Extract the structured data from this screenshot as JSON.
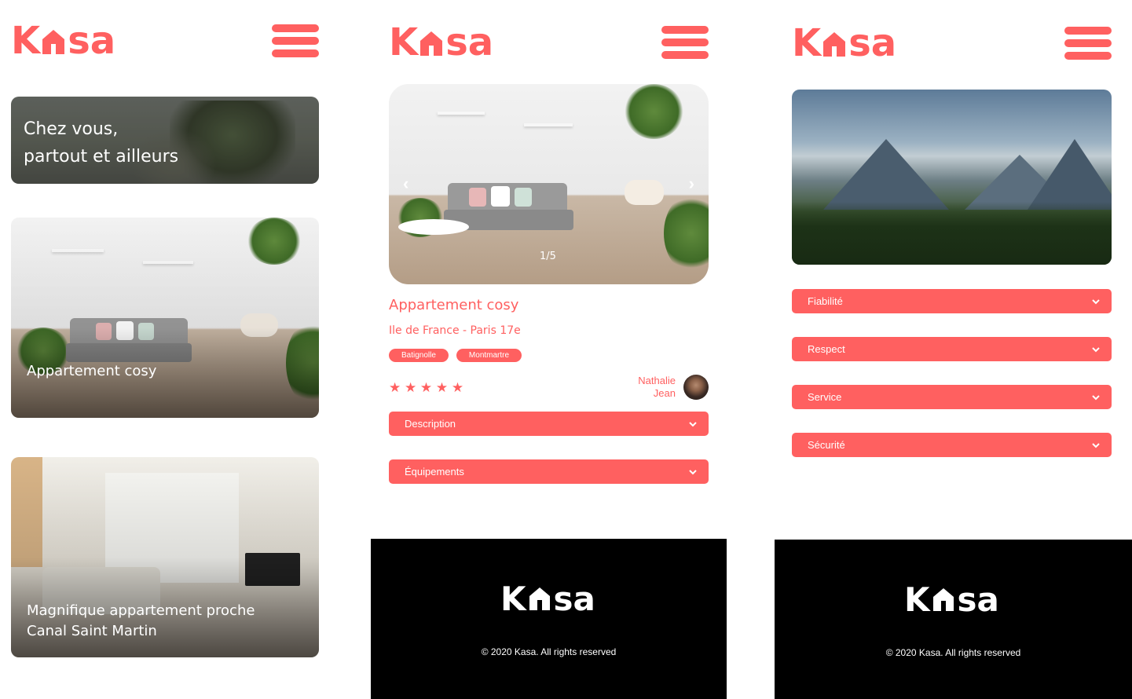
{
  "brand": {
    "logo_before": "K",
    "logo_after": "sa",
    "accent_color": "#FF6060",
    "menu_icon": "hamburger-icon"
  },
  "home": {
    "banner_line1": "Chez vous,",
    "banner_line2": "partout et ailleurs",
    "cards": [
      {
        "title": "Appartement cosy"
      },
      {
        "title": "Magnifique appartement proche Canal Saint Martin"
      }
    ]
  },
  "detail": {
    "counter": "1/5",
    "prev_icon": "chevron-left-icon",
    "next_icon": "chevron-right-icon",
    "title": "Appartement cosy",
    "location": "Ile de France - Paris 17e",
    "tags": [
      "Batignolle",
      "Montmartre"
    ],
    "rating": 5,
    "stars": "★ ★ ★ ★ ★",
    "host_first": "Nathalie",
    "host_last": "Jean",
    "collapses": [
      "Description",
      "Équipements"
    ]
  },
  "about": {
    "collapses": [
      "Fiabilité",
      "Respect",
      "Service",
      "Sécurité"
    ]
  },
  "footer": {
    "copyright": "© 2020 Kasa. All rights reserved"
  }
}
